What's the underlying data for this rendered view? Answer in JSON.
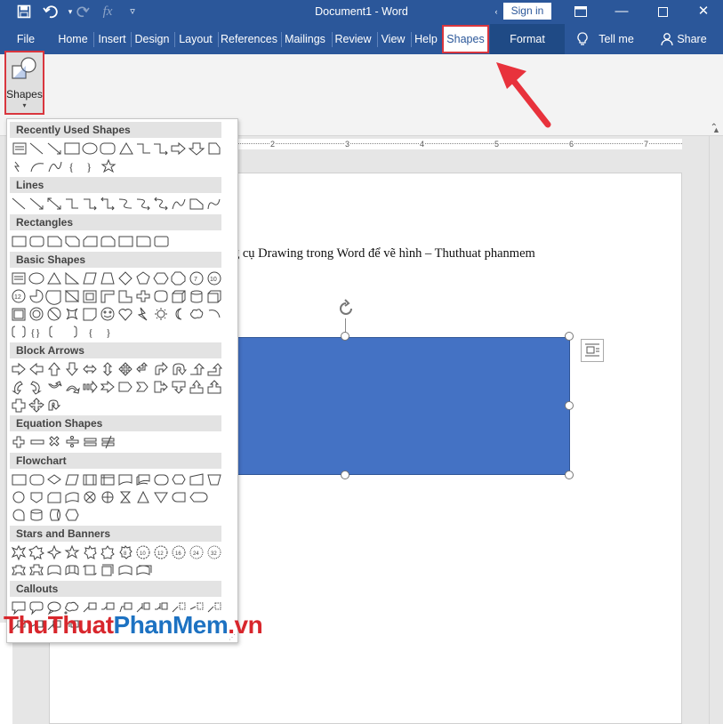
{
  "window": {
    "title": "Document1  -  Word",
    "sign_in": "Sign in"
  },
  "tabs": [
    "File",
    "Home",
    "Insert",
    "Design",
    "Layout",
    "References",
    "Mailings",
    "Review",
    "View",
    "Help",
    "Shapes",
    "Format",
    "Tell me",
    "Share"
  ],
  "ribbon": {
    "shapes_button": "Shapes"
  },
  "ruler": {
    "numbers": [
      "2",
      "3",
      "4",
      "5",
      "6",
      "7"
    ]
  },
  "document": {
    "text": "g cụ Drawing trong Word để vẽ hình – Thuthuat phanmem"
  },
  "gallery": {
    "categories": [
      "Recently Used Shapes",
      "Lines",
      "Rectangles",
      "Basic Shapes",
      "Block Arrows",
      "Equation Shapes",
      "Flowchart",
      "Stars and Banners",
      "Callouts"
    ]
  },
  "watermark": {
    "part1": "ThuThuat",
    "part2": "PhanMem",
    "part3": ".vn"
  },
  "colors": {
    "title_bar": "#2b579a",
    "shape_fill": "#4472c4",
    "highlight": "#d9363e"
  }
}
